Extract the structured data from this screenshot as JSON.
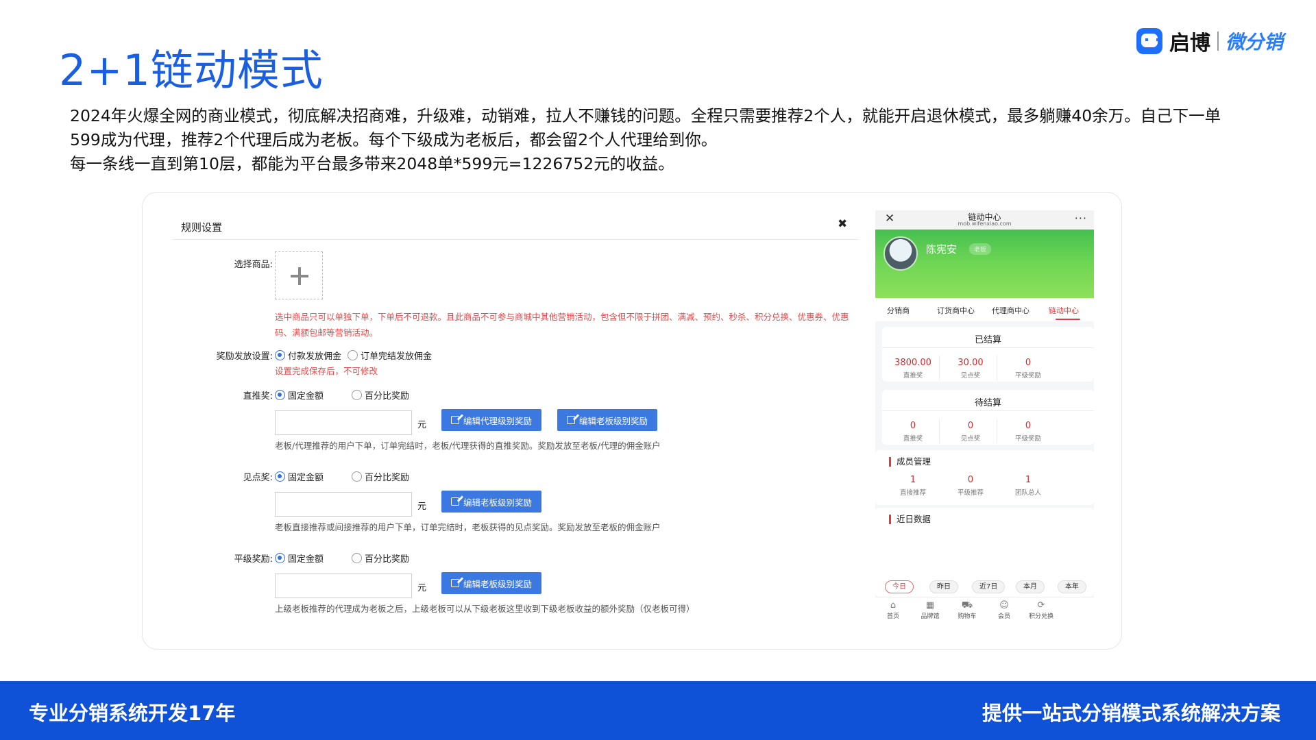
{
  "slide": {
    "title": "2+1链动模式",
    "brand_name": "启博",
    "brand_sub": "微分销",
    "intro_lines": [
      "2024年火爆全网的商业模式，彻底解决招商难，升级难，动销难，拉人不赚钱的问题。全程只需要推荐2个人，就能开启退休模式，最多躺赚40余万。自己下一单",
      "599成为代理，推荐2个代理后成为老板。每个下级成为老板后，都会留2个人代理给到你。",
      "每一条线一直到第10层，都能为平台最多带来2048单*599元=1226752元的收益。"
    ]
  },
  "dialog": {
    "title": "规则设置",
    "close_icon": "✖",
    "product_label": "选择商品:",
    "product_warning": "选中商品只可以单独下单，下单后不可退款。且此商品不可参与商城中其他营销活动，包含但不限于拼团、满减、预约、秒杀、积分兑换、优惠券、优惠码、满额包邮等营销活动。",
    "reward_label": "奖励发放设置:",
    "reward_options": [
      "付款发放佣金",
      "订单完结发放佣金"
    ],
    "reward_note": "设置完成保存后，不可修改",
    "direct": {
      "label": "直推奖:",
      "options": [
        "固定金额",
        "百分比奖励"
      ],
      "value": "",
      "unit": "元",
      "buttons": [
        "编辑代理级别奖励",
        "编辑老板级别奖励"
      ],
      "help": "老板/代理推荐的用户下单，订单完结时，老板/代理获得的直推奖励。奖励发放至老板/代理的佣金账户"
    },
    "point": {
      "label": "见点奖:",
      "options": [
        "固定金额",
        "百分比奖励"
      ],
      "value": "",
      "unit": "元",
      "buttons": [
        "编辑老板级别奖励"
      ],
      "help": "老板直接推荐或间接推荐的用户下单，订单完结时，老板获得的见点奖励。奖励发放至老板的佣金账户"
    },
    "level": {
      "label": "平级奖励:",
      "options": [
        "固定金额",
        "百分比奖励"
      ],
      "value": "",
      "unit": "元",
      "buttons": [
        "编辑老板级别奖励"
      ],
      "help": "上级老板推荐的代理成为老板之后，上级老板可以从下级老板这里收到下级老板收益的额外奖励（仅老板可得）"
    }
  },
  "phone": {
    "title": "链动中心",
    "url": "mob.wifenxiao.com",
    "user_name": "陈宪安",
    "user_tag": "老板",
    "tabs": [
      "分销商",
      "订货商中心",
      "代理商中心",
      "链动中心"
    ],
    "settled": {
      "title": "已结算",
      "stats": [
        {
          "value": "3800.00",
          "label": "直推奖"
        },
        {
          "value": "30.00",
          "label": "见点奖"
        },
        {
          "value": "0",
          "label": "平级奖励"
        }
      ]
    },
    "pending": {
      "title": "待结算",
      "stats": [
        {
          "value": "0",
          "label": "直推奖"
        },
        {
          "value": "0",
          "label": "见点奖"
        },
        {
          "value": "0",
          "label": "平级奖励"
        }
      ]
    },
    "members": {
      "title": "成员管理",
      "stats": [
        {
          "value": "1",
          "label": "直接推荐"
        },
        {
          "value": "0",
          "label": "平级推荐"
        },
        {
          "value": "1",
          "label": "团队总人"
        }
      ]
    },
    "recent": {
      "title": "近日数据",
      "chips": [
        "今日",
        "昨日",
        "近7日",
        "本月",
        "本年"
      ]
    },
    "nav": [
      {
        "icon": "⌂",
        "label": "首页"
      },
      {
        "icon": "▦",
        "label": "品牌馆"
      },
      {
        "icon": "⛟",
        "label": "购物车"
      },
      {
        "icon": "☺",
        "label": "会员"
      },
      {
        "icon": "⟳",
        "label": "积分兑换"
      }
    ]
  },
  "footer": {
    "left": "专业分销系统开发17年",
    "right": "提供一站式分销模式系统解决方案"
  }
}
